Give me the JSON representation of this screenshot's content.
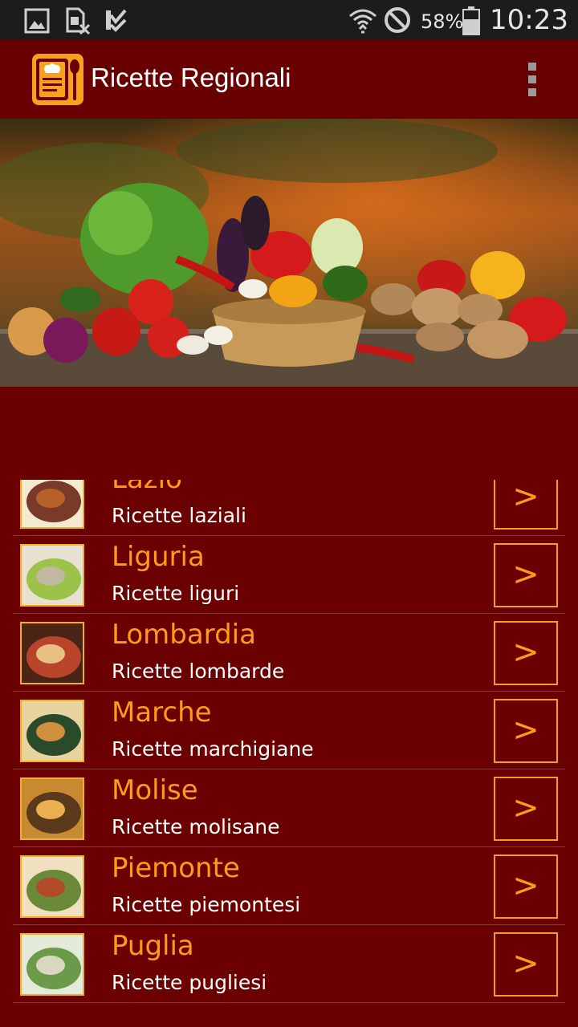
{
  "status_bar": {
    "icons": [
      "image-icon",
      "sim-card-x-icon",
      "check-clipboard-icon",
      "wifi-icon",
      "do-not-disturb-icon",
      "battery-icon"
    ],
    "battery_percent": "58%",
    "clock": "10:23"
  },
  "app_bar": {
    "title": "Ricette Regionali",
    "logo_icon": "recipe-book-icon",
    "menu_icon": "overflow-menu-icon"
  },
  "colors": {
    "background": "#6b0000",
    "accent": "#ff9a1a",
    "status_bar": "#1c1c1c"
  },
  "regions": [
    {
      "title": "Lazio",
      "subtitle": "Ricette laziali",
      "button": ">"
    },
    {
      "title": "Liguria",
      "subtitle": "Ricette liguri",
      "button": ">"
    },
    {
      "title": "Lombardia",
      "subtitle": "Ricette lombarde",
      "button": ">"
    },
    {
      "title": "Marche",
      "subtitle": "Ricette marchigiane",
      "button": ">"
    },
    {
      "title": "Molise",
      "subtitle": "Ricette molisane",
      "button": ">"
    },
    {
      "title": "Piemonte",
      "subtitle": "Ricette piemontesi",
      "button": ">"
    },
    {
      "title": "Puglia",
      "subtitle": "Ricette pugliesi",
      "button": ">"
    }
  ]
}
